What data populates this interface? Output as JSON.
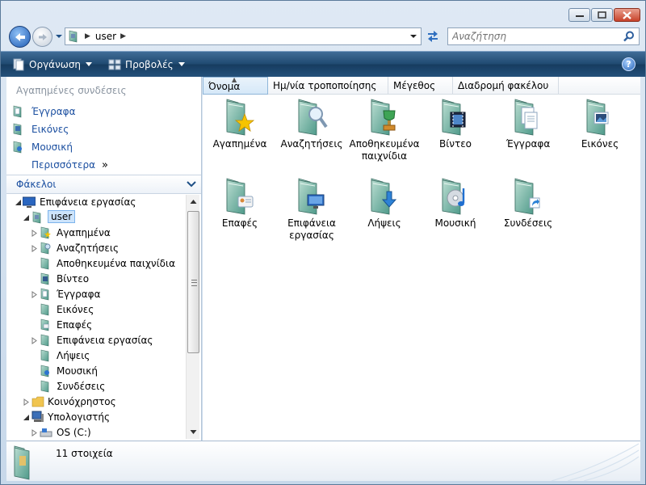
{
  "address": {
    "crumb": "user"
  },
  "search": {
    "placeholder": "Αναζήτηση"
  },
  "toolbar": {
    "organize": "Οργάνωση",
    "views": "Προβολές"
  },
  "nav": {
    "favorites_title": "Αγαπημένες συνδέσεις",
    "favorites": [
      {
        "label": "Έγγραφα"
      },
      {
        "label": "Εικόνες"
      },
      {
        "label": "Μουσική"
      }
    ],
    "more": "Περισσότερα",
    "folders_title": "Φάκελοι",
    "tree": [
      {
        "label": "Επιφάνεια εργασίας"
      },
      {
        "label": "user"
      },
      {
        "label": "Αγαπημένα"
      },
      {
        "label": "Αναζητήσεις"
      },
      {
        "label": "Αποθηκευμένα παιχνίδια"
      },
      {
        "label": "Βίντεο"
      },
      {
        "label": "Έγγραφα"
      },
      {
        "label": "Εικόνες"
      },
      {
        "label": "Επαφές"
      },
      {
        "label": "Επιφάνεια εργασίας"
      },
      {
        "label": "Λήψεις"
      },
      {
        "label": "Μουσική"
      },
      {
        "label": "Συνδέσεις"
      },
      {
        "label": "Κοινόχρηστος"
      },
      {
        "label": "Υπολογιστής"
      },
      {
        "label": "OS (C:)"
      }
    ]
  },
  "columns": {
    "name": "Όνομα",
    "modified": "Ημ/νία τροποποίησης",
    "size": "Μέγεθος",
    "path": "Διαδρομή φακέλου"
  },
  "items": [
    {
      "line1": "Αγαπημένα",
      "line2": ""
    },
    {
      "line1": "Αναζητήσεις",
      "line2": ""
    },
    {
      "line1": "Αποθηκευμένα",
      "line2": "παιχνίδια"
    },
    {
      "line1": "Βίντεο",
      "line2": ""
    },
    {
      "line1": "Έγγραφα",
      "line2": ""
    },
    {
      "line1": "Εικόνες",
      "line2": ""
    },
    {
      "line1": "Επαφές",
      "line2": ""
    },
    {
      "line1": "Επιφάνεια",
      "line2": "εργασίας"
    },
    {
      "line1": "Λήψεις",
      "line2": ""
    },
    {
      "line1": "Μουσική",
      "line2": ""
    },
    {
      "line1": "Συνδέσεις",
      "line2": ""
    }
  ],
  "status": {
    "count": "11 στοιχεία"
  }
}
